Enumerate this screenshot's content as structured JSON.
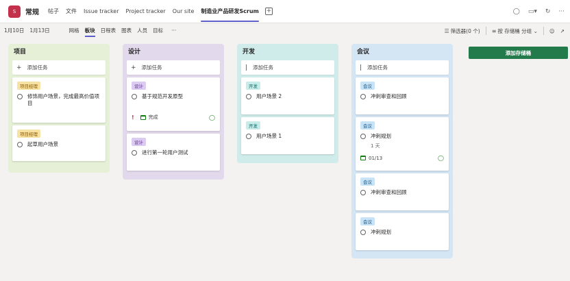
{
  "header": {
    "team_initial": "S",
    "channel": "常规",
    "tabs": [
      "帖子",
      "文件",
      "Issue tracker",
      "Project tracker",
      "Our site",
      "制造业产品研发Scrum"
    ],
    "active_tab": "制造业产品研发Scrum",
    "icons": [
      "chat-icon",
      "video-icon",
      "refresh-icon",
      "more-icon"
    ]
  },
  "toolbar": {
    "date_start": "1月10日",
    "date_end": "1月13日",
    "views": [
      "网格",
      "板块",
      "日程表",
      "图表",
      "人员",
      "目标"
    ],
    "active_view": "板块",
    "more": "···",
    "filter_label": "筛选器(0 个)",
    "group_label": "按 存储桶 分组"
  },
  "colors": {
    "accent": "#5b5fc7",
    "add_bucket": "#237b4b",
    "bucket_green": "#e5f0d6",
    "bucket_purple": "#e3d9ed",
    "bucket_teal": "#d0ecea",
    "bucket_blue": "#d4e5f4"
  },
  "board": {
    "add_task_label": "添加任务",
    "add_bucket_label": "添加存储桶",
    "buckets": [
      {
        "title": "项目",
        "tasks": [
          {
            "label": "项目经理",
            "title": "修饰用户场景，完成最高价值项目"
          },
          {
            "label": "项目经理",
            "title": "起草用户场景"
          }
        ]
      },
      {
        "title": "设计",
        "tasks": [
          {
            "label": "设计",
            "title": "基于规范开发原型",
            "priority": "!",
            "status": "完成"
          },
          {
            "label": "设计",
            "title": "进行第一轮用户测试"
          }
        ]
      },
      {
        "title": "开发",
        "tasks": [
          {
            "label": "开发",
            "title": "用户场景 2"
          },
          {
            "label": "开发",
            "title": "用户场景 1"
          }
        ]
      },
      {
        "title": "会议",
        "tasks": [
          {
            "label": "会议",
            "title": "冲刺审查和回顾"
          },
          {
            "label": "会议",
            "title": "冲刺规划",
            "sub": "1 天",
            "date": "01/13"
          },
          {
            "label": "会议",
            "title": "冲刺审查和回顾"
          },
          {
            "label": "会议",
            "title": "冲刺规划"
          }
        ]
      }
    ]
  }
}
